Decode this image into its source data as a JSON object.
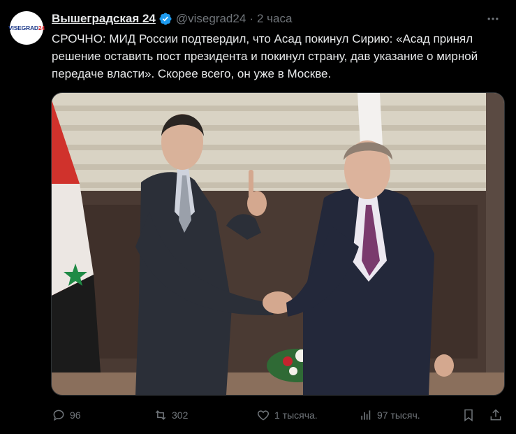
{
  "author": {
    "display_name": "Вышеградская 24",
    "handle": "@visegrad24",
    "separator": "·",
    "time": "2 часа",
    "avatar_text_main": "VISEGRAD",
    "avatar_text_accent": "24"
  },
  "tweet": {
    "text": "СРОЧНО: МИД России подтвердил, что Асад покинул Сирию: «Асад принял решение оставить пост президента и покинул страну, дав указание о мирной передаче власти». Скорее всего, он уже в Москве."
  },
  "media": {
    "description_icon": "photo"
  },
  "actions": {
    "replies": "96",
    "reposts": "302",
    "likes": "1 тысяча.",
    "views": "97 тысяч."
  },
  "colors": {
    "background": "#000000",
    "text": "#e7e9ea",
    "muted": "#71767b",
    "verified": "#1d9bf0"
  }
}
